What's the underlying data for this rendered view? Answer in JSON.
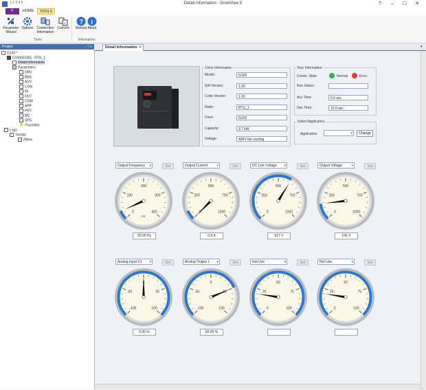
{
  "titlebar": {
    "qat": "1 2 3 4 5",
    "title": "Detail Information - DriveView 9"
  },
  "ribbon": {
    "file_tab": "F",
    "tabs": [
      "HOME",
      "TOOLS"
    ],
    "buttons": [
      {
        "label": "Parameter\nWizard"
      },
      {
        "label": "Options"
      },
      {
        "label": "Connection\nInformation"
      },
      {
        "label": "Convert"
      },
      {
        "label": "Manual"
      },
      {
        "label": "About"
      }
    ],
    "groups": [
      "Tools",
      "Information"
    ]
  },
  "project": {
    "header": "Project",
    "header_icons": "▾ ᛘ ✕",
    "tree": [
      {
        "label": "G100 *"
      },
      {
        "label": "G100(G100) - RTU_1"
      },
      {
        "label": "Detail Information"
      },
      {
        "label": "Parameters"
      },
      {
        "label": "DRV"
      },
      {
        "label": "BAS"
      },
      {
        "label": "ADV"
      },
      {
        "label": "CON"
      },
      {
        "label": "IN"
      },
      {
        "label": "OUT"
      },
      {
        "label": "COM"
      },
      {
        "label": "APP"
      },
      {
        "label": "PRT"
      },
      {
        "label": "M2"
      },
      {
        "label": "SPS"
      },
      {
        "label": "Favorites"
      },
      {
        "label": "Logs"
      },
      {
        "label": "Trends"
      },
      {
        "label": "#New"
      }
    ]
  },
  "doc_tab": {
    "label": "Detail Information",
    "close": "✕"
  },
  "drive_info": {
    "title": "Drive Information",
    "rows": [
      {
        "label": "Model:",
        "value": "G100"
      },
      {
        "label": "SW Version:",
        "value": "1.00"
      },
      {
        "label": "Code Version:",
        "value": "1.00"
      },
      {
        "label": "Node:",
        "value": "RTU_1"
      },
      {
        "label": "Drive:",
        "value": "G100"
      },
      {
        "label": "Capacity:",
        "value": "3.7 kW"
      },
      {
        "label": "Voltage:",
        "value": "400V fan cooling"
      }
    ]
  },
  "run_info": {
    "title": "Run Information",
    "comm_label": "Comm. State",
    "normal_label": "Normal",
    "error_label": "Error",
    "normal_color": "#2db34a",
    "error_color": "#e53935",
    "rows": [
      {
        "label": "Run Status:",
        "value": ""
      },
      {
        "label": "Acc Time:",
        "value": "5.0 sec"
      },
      {
        "label": "Dec Time:",
        "value": "10.0 sec"
      }
    ]
  },
  "select_app": {
    "title": "Select Application",
    "label": "Application",
    "value": "",
    "change": "Change"
  },
  "gauges": [
    {
      "select": "Output Frequency",
      "set": "Set",
      "ticks": [
        "0",
        "100",
        "200",
        "300",
        "400"
      ],
      "unit_label": "Hz",
      "value_fraction": 0.075,
      "readout": "30.00 Hz",
      "arc": "min"
    },
    {
      "select": "Output Current",
      "set": "Set",
      "ticks": [
        "0",
        "250",
        "500",
        "750",
        "1000"
      ],
      "unit_label": "",
      "value_fraction": 0.0,
      "readout": "0.0 A",
      "arc": "min"
    },
    {
      "select": "DC Link Voltage",
      "set": "Set",
      "ticks": [
        "0",
        "250",
        "500",
        "750",
        "1000"
      ],
      "unit_label": "",
      "value_fraction": 0.617,
      "readout": "617 V",
      "arc": "to_value"
    },
    {
      "select": "Output Voltage",
      "set": "Set",
      "ticks": [
        "0",
        "250",
        "500",
        "750",
        "1000"
      ],
      "unit_label": "",
      "value_fraction": 0.141,
      "readout": "141 V",
      "arc": "to_value"
    },
    {
      "select": "Analog Input V1",
      "set": "Set",
      "ticks": [
        "-100",
        "-50",
        "0",
        "50",
        "100"
      ],
      "unit_label": "",
      "value_fraction": 0.5,
      "readout": "0.00 %",
      "arc": "full"
    },
    {
      "select": "Analog Output 1",
      "set": "Set",
      "ticks": [
        "-100",
        "-50",
        "0",
        "50",
        "100"
      ],
      "unit_label": "",
      "value_fraction": 0.75,
      "readout": "50.00 %",
      "arc": "to_value"
    },
    {
      "select": "Not Use",
      "set": "Set",
      "ticks": [
        "0",
        "25",
        "50",
        "75",
        "100"
      ],
      "unit_label": "",
      "value_fraction": 0.2,
      "readout": "",
      "arc": "full"
    },
    {
      "select": "Not Use",
      "set": "Set",
      "ticks": [
        "0",
        "25",
        "50",
        "75",
        "100"
      ],
      "unit_label": "",
      "value_fraction": 0.2,
      "readout": "",
      "arc": "full"
    }
  ]
}
